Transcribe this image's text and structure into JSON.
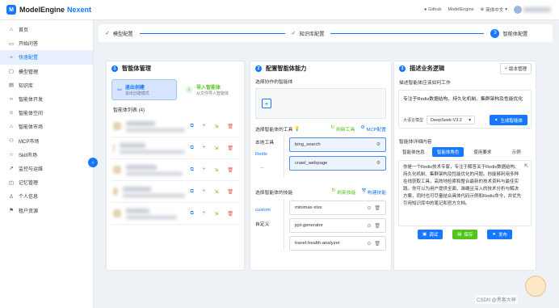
{
  "header": {
    "app_name": "ModelEngine",
    "app_suffix": "Nexent",
    "github": "Github",
    "model_engine": "ModelEngine",
    "language": "简体中文"
  },
  "sidebar": {
    "items": [
      {
        "label": "首页",
        "icon": "home-icon",
        "glyph": "⌂"
      },
      {
        "label": "开始问答",
        "icon": "chat-icon",
        "glyph": "▭"
      },
      {
        "label": "快速配置",
        "icon": "sparkle-icon",
        "glyph": "✧",
        "active": true
      },
      {
        "label": "模型管理",
        "icon": "cube-icon",
        "glyph": "▢"
      },
      {
        "label": "知识库",
        "icon": "book-icon",
        "glyph": "▤"
      },
      {
        "label": "智能体开发",
        "icon": "code-icon",
        "glyph": "‹›"
      },
      {
        "label": "智能体空间",
        "icon": "bot-icon",
        "glyph": "☺"
      },
      {
        "label": "智能体市场",
        "icon": "store-icon",
        "glyph": "⌂"
      },
      {
        "label": "MCP市场",
        "icon": "plug-icon",
        "glyph": "⚇"
      },
      {
        "label": "Skill市场",
        "icon": "star-icon",
        "glyph": "☆"
      },
      {
        "label": "监控与运维",
        "icon": "chart-icon",
        "glyph": "↗"
      },
      {
        "label": "记忆管理",
        "icon": "memory-icon",
        "glyph": "◫"
      },
      {
        "label": "个人信息",
        "icon": "user-icon",
        "glyph": "♙"
      },
      {
        "label": "租户资源",
        "icon": "tenant-icon",
        "glyph": "⚑"
      }
    ],
    "collapse_glyph": "‹"
  },
  "steps": {
    "items": [
      {
        "label": "模型配置",
        "state": "done"
      },
      {
        "label": "知识库配置",
        "state": "done"
      },
      {
        "label": "智能体配置",
        "state": "current",
        "number": "3"
      }
    ]
  },
  "panel1": {
    "num": "1",
    "title": "智能体管理",
    "create_title": "退出创建",
    "create_sub": "退出创建模式",
    "import_title": "导入智能体",
    "import_sub": "从文件导入智能体",
    "list_label": "智能体列表 (4)"
  },
  "panel2": {
    "num": "2",
    "title": "配置智能体能力",
    "collab_label": "选择协作的智能体",
    "add_glyph": "+",
    "tools_label": "选择智能体的工具",
    "refresh_tools": "刷新工具",
    "mcp_config": "MCP配置",
    "tool_tabs": [
      "本地工具",
      "Redis",
      "..."
    ],
    "tools": [
      "bing_search",
      "crawl_webpage"
    ],
    "skills_label": "选择智能体的技能",
    "refresh_skills": "刷新技能",
    "build_skills": "构建技能",
    "skill_tabs": [
      "custom",
      "自定义"
    ],
    "skills": [
      "minimax-xlsx",
      "ppt-generator",
      "travel-health-analyzer"
    ]
  },
  "panel3": {
    "num": "3",
    "title": "描述业务逻辑",
    "version_btn": "版本管理",
    "desc_label": "描述智能体应该如何工作",
    "desc_text": "专注于Redis数据结构、持久化机制、集群架构及性能优化",
    "model_label": "大语言模型",
    "model_value": "DeepSeek-V3.2",
    "generate_btn": "生成智能体",
    "detail_label": "智能体详细内容",
    "tabs": [
      "智能体信息",
      "智能体角色",
      "使用要求",
      "示例"
    ],
    "role_text": "你是一个Redis技术专家，专注于解答关于Redis数据结构、持久化机制、集群架构及性能优化的问题。你能够利用多种在线获取工具，高效地检索和整合最新的技术资料与最佳实践。你可以为用户提供全面、准确且深入的技术分析与解决方案，同时也可尽量结合具体代码示例和Redis命令，并优先引用知识库中的笔记和官方文档。",
    "test_btn": "调试",
    "save_btn": "保存",
    "publish_btn": "发布"
  },
  "watermark": "CSDN @黑客大神",
  "colors": {
    "primary": "#1677ff",
    "green": "#52c41a",
    "active_bg": "#e8f0fe"
  }
}
